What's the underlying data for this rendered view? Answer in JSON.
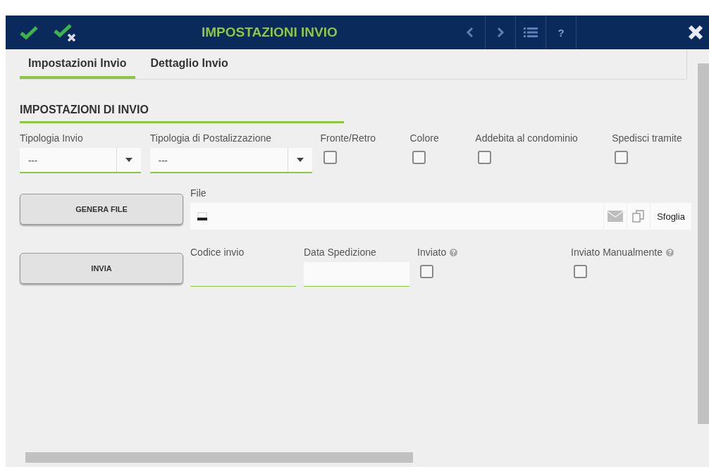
{
  "window": {
    "title": "IMPOSTAZIONI INVIO",
    "help": "?"
  },
  "tabs": [
    {
      "label": "Impostazioni Invio",
      "selected": true
    },
    {
      "label": "Dettaglio Invio",
      "selected": false
    }
  ],
  "section_title": "IMPOSTAZIONI DI INVIO",
  "row1": [
    {
      "kind": "select",
      "label": "Tipologia Invio",
      "value": "---"
    },
    {
      "kind": "select",
      "label": "Tipologia di Postalizzazione",
      "value": "---"
    },
    {
      "kind": "checkbox",
      "label": "Fronte/Retro",
      "checked": false
    },
    {
      "kind": "checkbox",
      "label": "Colore",
      "checked": false
    },
    {
      "kind": "checkbox",
      "label": "Addebita al condominio",
      "checked": false
    },
    {
      "kind": "checkbox",
      "label": "Spedisci tramite",
      "checked": false
    }
  ],
  "generate_button": "GENERA FILE",
  "file": {
    "label": "File",
    "browse": "Sfoglia"
  },
  "send_button": "INVIA",
  "row3": [
    {
      "kind": "line",
      "label": "Codice invio"
    },
    {
      "kind": "box",
      "label": "Data Spedizione"
    },
    {
      "kind": "checkbox",
      "label": "Inviato",
      "checked": false,
      "help": true
    },
    {
      "kind": "checkbox",
      "label": "Inviato Manualmente",
      "checked": false,
      "help": true
    }
  ]
}
